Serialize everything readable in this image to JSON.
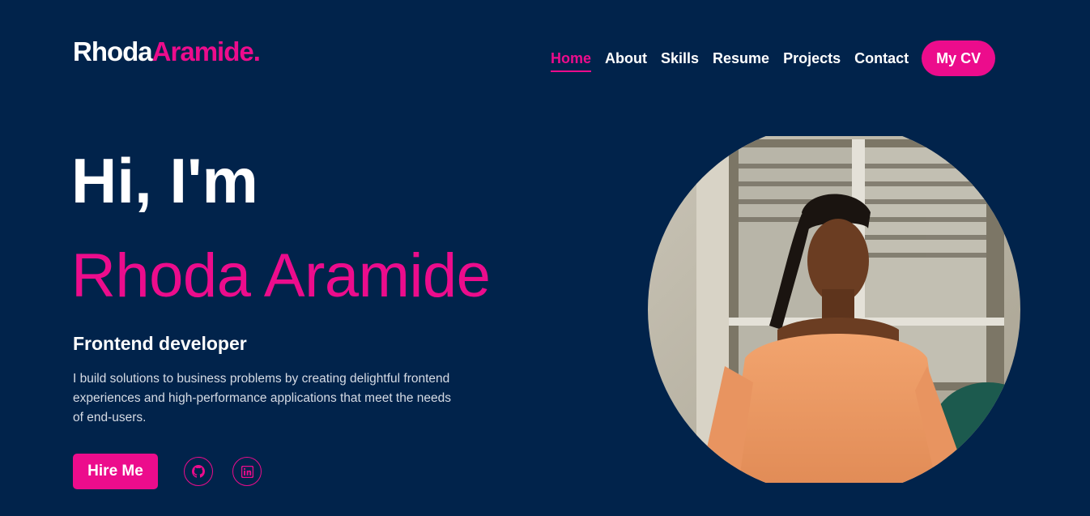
{
  "header": {
    "logo_first": "Rhoda",
    "logo_last": "Aramide.",
    "nav": [
      {
        "label": "Home",
        "active": true
      },
      {
        "label": "About",
        "active": false
      },
      {
        "label": "Skills",
        "active": false
      },
      {
        "label": "Resume",
        "active": false
      },
      {
        "label": "Projects",
        "active": false
      },
      {
        "label": "Contact",
        "active": false
      }
    ],
    "cv_label": "My CV"
  },
  "hero": {
    "greeting": "Hi, I'm",
    "name": "Rhoda Aramide",
    "role": "Frontend developer",
    "bio": "I build solutions to business problems by creating delightful frontend experiences and high-performance applications that meet the needs of end-users.",
    "hire_label": "Hire Me",
    "socials": [
      {
        "icon": "github-icon"
      },
      {
        "icon": "linkedin-icon"
      }
    ]
  },
  "colors": {
    "background": "#01234b",
    "accent": "#ec0c8c",
    "text": "#ffffff"
  }
}
